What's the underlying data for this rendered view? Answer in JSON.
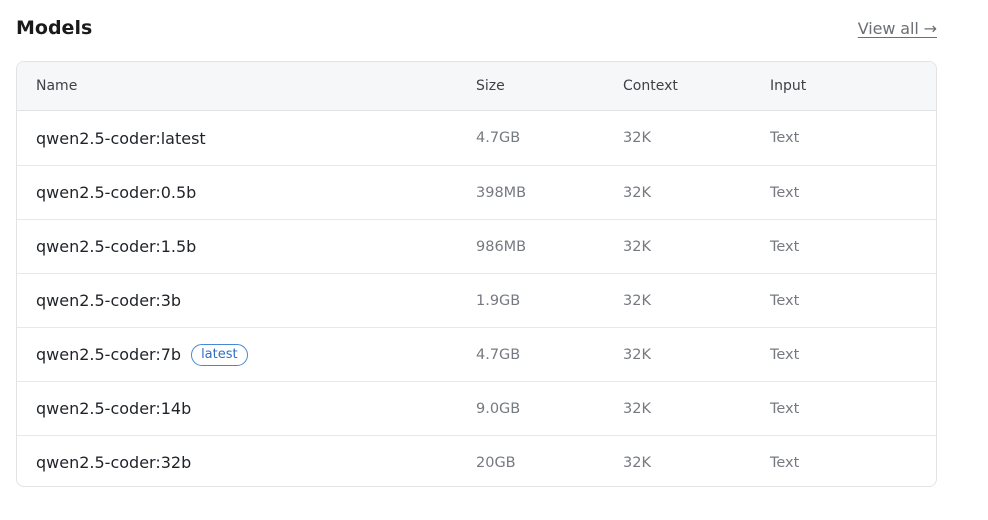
{
  "header": {
    "title": "Models",
    "view_all": "View all →"
  },
  "table": {
    "columns": {
      "name": "Name",
      "size": "Size",
      "context": "Context",
      "input": "Input"
    },
    "rows": [
      {
        "name": "qwen2.5-coder:latest",
        "size": "4.7GB",
        "context": "32K",
        "input": "Text",
        "badge": ""
      },
      {
        "name": "qwen2.5-coder:0.5b",
        "size": "398MB",
        "context": "32K",
        "input": "Text",
        "badge": ""
      },
      {
        "name": "qwen2.5-coder:1.5b",
        "size": "986MB",
        "context": "32K",
        "input": "Text",
        "badge": ""
      },
      {
        "name": "qwen2.5-coder:3b",
        "size": "1.9GB",
        "context": "32K",
        "input": "Text",
        "badge": ""
      },
      {
        "name": "qwen2.5-coder:7b",
        "size": "4.7GB",
        "context": "32K",
        "input": "Text",
        "badge": "latest"
      },
      {
        "name": "qwen2.5-coder:14b",
        "size": "9.0GB",
        "context": "32K",
        "input": "Text",
        "badge": ""
      },
      {
        "name": "qwen2.5-coder:32b",
        "size": "20GB",
        "context": "32K",
        "input": "Text",
        "badge": ""
      }
    ]
  }
}
